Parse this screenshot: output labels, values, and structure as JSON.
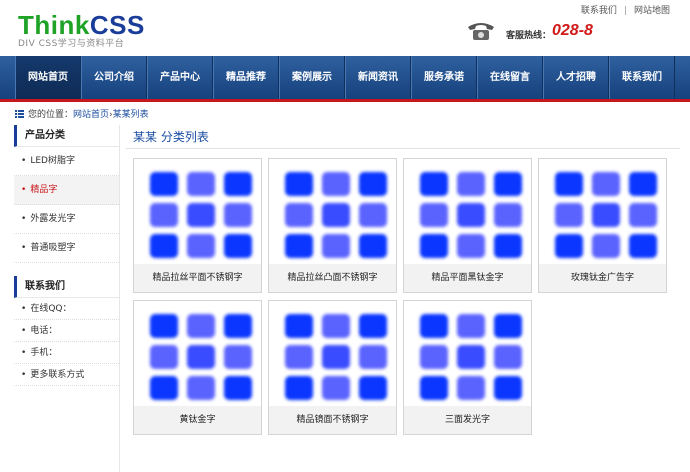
{
  "logo": {
    "think": "Think",
    "css": "CSS",
    "subtitle": "DIV CSS学习与资料平台"
  },
  "toplinks": [
    "联系我们",
    "网站地图"
  ],
  "hotline": {
    "label": "客服热线：",
    "number": "028-8"
  },
  "nav": [
    "网站首页",
    "公司介绍",
    "产品中心",
    "精品推荐",
    "案例展示",
    "新闻资讯",
    "服务承诺",
    "在线留言",
    "人才招聘",
    "联系我们"
  ],
  "breadcrumb": {
    "prefix": "您的位置：",
    "home": "网站首页",
    "separator": "›",
    "current": "某某列表"
  },
  "sidebar": {
    "category_title": "产品分类",
    "categories": [
      "LED树脂字",
      "精品字",
      "外露发光字",
      "普通吸塑字"
    ],
    "active_index": 1,
    "contact_title": "联系我们",
    "contacts": [
      "在线QQ：",
      "电话：",
      "手机：",
      "更多联系方式"
    ]
  },
  "main": {
    "title": "某某 分类列表",
    "products": [
      "精品拉丝平面不锈钢字",
      "精品拉丝凸面不锈钢字",
      "精品平面黑钛金字",
      "玫瑰钛金广告字",
      "黄钛金字",
      "精品镜面不锈钢字",
      "三面发光字"
    ]
  },
  "colors": {
    "accent": "#1b3d9a",
    "nav": "#16427d",
    "nav_border": "#c8171c",
    "thumb_blue": "#1a3cff"
  }
}
